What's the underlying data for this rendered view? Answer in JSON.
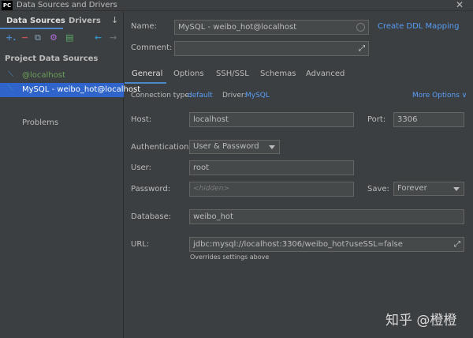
{
  "window": {
    "title": "Data Sources and Drivers",
    "app_icon_text": "PC",
    "close_glyph": "✕"
  },
  "left": {
    "tabs": [
      {
        "label": "Data Sources"
      },
      {
        "label": "Drivers"
      }
    ],
    "tab_arrow": "↓",
    "toolbar": {
      "add": "+.",
      "remove": "−",
      "copy": "⧉",
      "settings": "⚙",
      "export": "▤",
      "back": "←",
      "forward": "→"
    },
    "section_title": "Project Data Sources",
    "items": [
      {
        "label": "@localhost",
        "icon": "datasource-icon"
      },
      {
        "label": "MySQL - weibo_hot@localhost",
        "icon": "datasource-icon"
      }
    ],
    "problems": "Problems"
  },
  "form": {
    "name_label": "Name:",
    "name_value": "MySQL - weibo_hot@localhost",
    "create_ddl": "Create DDL Mapping",
    "comment_label": "Comment:",
    "comment_value": "",
    "expand_glyph": "⤢",
    "tabs": [
      {
        "label": "General"
      },
      {
        "label": "Options"
      },
      {
        "label": "SSH/SSL"
      },
      {
        "label": "Schemas"
      },
      {
        "label": "Advanced"
      }
    ],
    "connection_type_label": "Connection type:",
    "connection_type_value": "default",
    "driver_label": "Driver:",
    "driver_value": "MySQL",
    "more_options": "More Options ∨",
    "host_label": "Host:",
    "host_value": "localhost",
    "port_label": "Port:",
    "port_value": "3306",
    "auth_label": "Authentication:",
    "auth_value": "User & Password",
    "user_label": "User:",
    "user_value": "root",
    "password_label": "Password:",
    "password_placeholder": "<hidden>",
    "save_label": "Save:",
    "save_value": "Forever",
    "database_label": "Database:",
    "database_value": "weibo_hot",
    "url_label": "URL:",
    "url_value": "jdbc:mysql://localhost:3306/weibo_hot?useSSL=false",
    "url_hint": "Overrides settings above"
  },
  "watermark": "知乎 @橙橙",
  "colors": {
    "accent": "#4a88c7",
    "link": "#589df6",
    "selection": "#2f65ca",
    "bg": "#3c3f41"
  }
}
